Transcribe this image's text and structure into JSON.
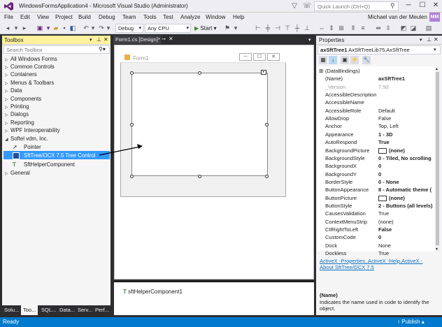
{
  "window": {
    "title": "WindowsFormsApplication4 - Microsoft Visual Studio (Administrator)",
    "quick_launch_placeholder": "Quick Launch (Ctrl+Q)",
    "user": "Michael van der Meulen",
    "avatar_initials": "MM",
    "minimize": "─",
    "maximize": "☐",
    "close": "✕"
  },
  "menu": [
    "File",
    "Edit",
    "View",
    "Project",
    "Build",
    "Debug",
    "Team",
    "Tools",
    "Test",
    "Analyze",
    "Window",
    "Help"
  ],
  "toolbar": {
    "config": "Debug",
    "platform": "Any CPU",
    "start": "Start"
  },
  "toolbox": {
    "title": "Toolbox",
    "search_placeholder": "Search Toolbox",
    "groups": [
      "All Windows Forms",
      "Common Controls",
      "Containers",
      "Menus & Toolbars",
      "Data",
      "Components",
      "Printing",
      "Dialogs",
      "Reporting",
      "WPF Interoperability",
      "Softel vdm, Inc."
    ],
    "softel_items": [
      "Pointer",
      "SftTree/OCX 7.5 Tree Control",
      "SftHelperComponent"
    ],
    "general": "General",
    "bottom_tabs": [
      "Solu...",
      "Too...",
      "SQL...",
      "Data...",
      "Serv...",
      "Perf..."
    ]
  },
  "designer": {
    "tab_label": "Form1.cs [Design]*",
    "form_title": "Form1",
    "tray_component": "sftHelperComponent1"
  },
  "properties": {
    "title": "Properties",
    "object_name": "axSftTree1",
    "object_type": "AxSftTreeLib75.AxSftTree",
    "rows": [
      {
        "name": "(DataBindings)",
        "value": "",
        "category": true
      },
      {
        "name": "(Name)",
        "value": "axSftTree1",
        "bold": true
      },
      {
        "name": "_Version",
        "value": "7.50",
        "grey": true
      },
      {
        "name": "AccessibleDescription",
        "value": ""
      },
      {
        "name": "AccessibleName",
        "value": ""
      },
      {
        "name": "AccessibleRole",
        "value": "Default"
      },
      {
        "name": "AllowDrop",
        "value": "False"
      },
      {
        "name": "Anchor",
        "value": "Top, Left"
      },
      {
        "name": "Appearance",
        "value": "1 - 3D",
        "bold": true
      },
      {
        "name": "AutoRespond",
        "value": "True",
        "bold": true
      },
      {
        "name": "BackgroundPicture",
        "value": "(none)",
        "bold": true,
        "swatch": true
      },
      {
        "name": "BackgroundStyle",
        "value": "0 - Tiled, No scrolling",
        "bold": true
      },
      {
        "name": "BackgroundX",
        "value": "0",
        "bold": true
      },
      {
        "name": "BackgroundY",
        "value": "0",
        "bold": true
      },
      {
        "name": "BorderStyle",
        "value": "0 - None",
        "bold": true
      },
      {
        "name": "ButtonAppearance",
        "value": "8 - Automatic theme (",
        "bold": true
      },
      {
        "name": "ButtonPicture",
        "value": "(none)",
        "bold": true,
        "swatch": true
      },
      {
        "name": "ButtonStyle",
        "value": "2 - Buttons (all levels)",
        "bold": true
      },
      {
        "name": "CausesValidation",
        "value": "True"
      },
      {
        "name": "ContextMenuStrip",
        "value": "(none)"
      },
      {
        "name": "CtlRightToLeft",
        "value": "False",
        "bold": true
      },
      {
        "name": "CustomCode",
        "value": "0",
        "bold": true
      },
      {
        "name": "Dock",
        "value": "None"
      },
      {
        "name": "Dockless",
        "value": "True"
      }
    ],
    "links": [
      "ActiveX -Properties...",
      "ActiveX -Help,",
      "ActiveX -",
      "About SftTree/OCX 7.5"
    ],
    "desc_title": "(Name)",
    "desc_text": "Indicates the name used in code to identify the object."
  },
  "status": {
    "left": "Ready",
    "right": "Publish"
  }
}
